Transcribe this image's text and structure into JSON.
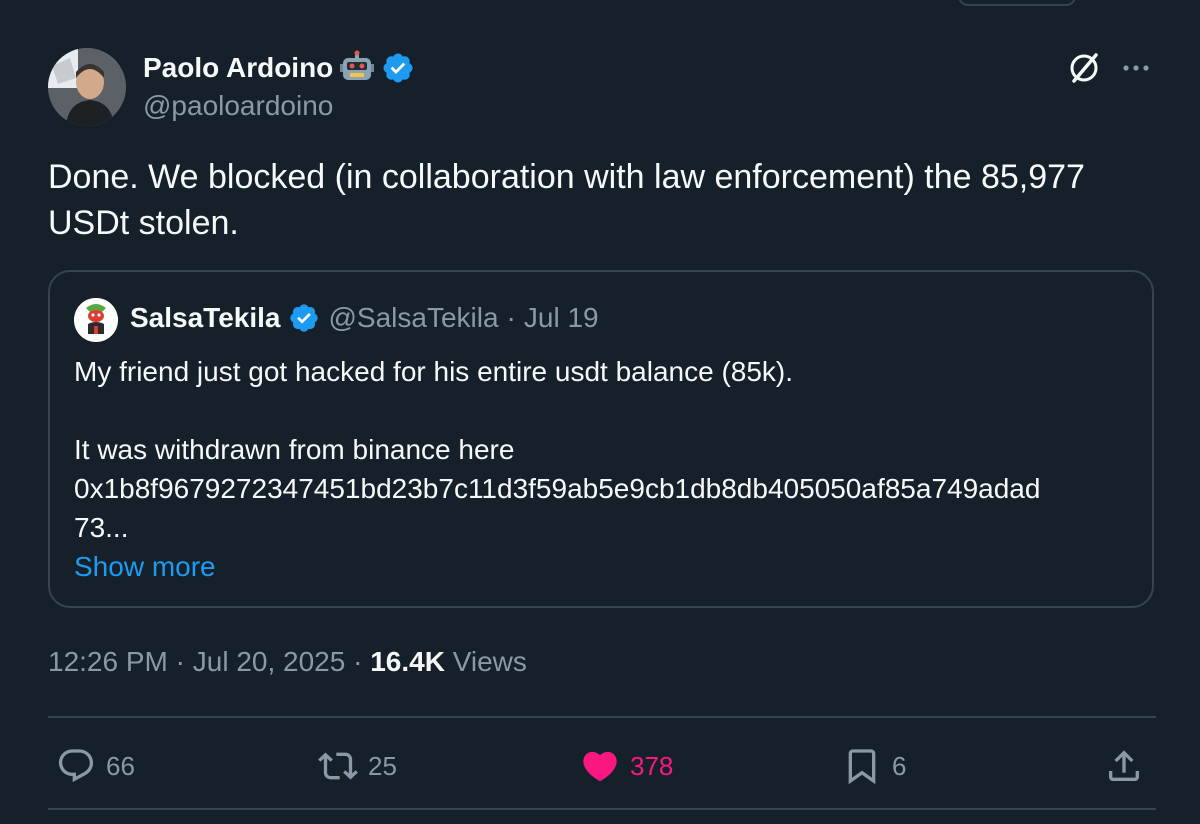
{
  "author": {
    "name": "Paolo Ardoino",
    "handle": "@paoloardoino"
  },
  "tweet": {
    "text_line1": "Done. We blocked (in collaboration with law enforcement) the 85,977",
    "text_line2": "USDt stolen."
  },
  "quote": {
    "name": "SalsaTekila",
    "handle": "@SalsaTekila",
    "separator": "·",
    "date": "Jul 19",
    "line1": "My friend just got hacked for his entire usdt balance (85k).",
    "line2": "It was withdrawn from binance here",
    "line3": "0x1b8f9679272347451bd23b7c11d3f59ab5e9cb1db8db405050af85a749adad",
    "line4": "73...",
    "show_more": "Show more"
  },
  "meta": {
    "time": "12:26 PM",
    "sep1": "·",
    "date": "Jul 20, 2025",
    "sep2": "·",
    "views_count": "16.4K",
    "views_label": "Views"
  },
  "actions": {
    "replies": "66",
    "reposts": "25",
    "likes": "378",
    "bookmarks": "6"
  },
  "colors": {
    "background": "#15202b",
    "accent": "#1d9bf0",
    "like": "#f91880",
    "muted": "#8b98a5",
    "border": "#38444d"
  },
  "icons": [
    "robot-emoji-icon",
    "verified-badge-icon",
    "grok-icon",
    "more-icon",
    "reply-icon",
    "repost-icon",
    "like-icon",
    "bookmark-icon",
    "share-icon"
  ]
}
